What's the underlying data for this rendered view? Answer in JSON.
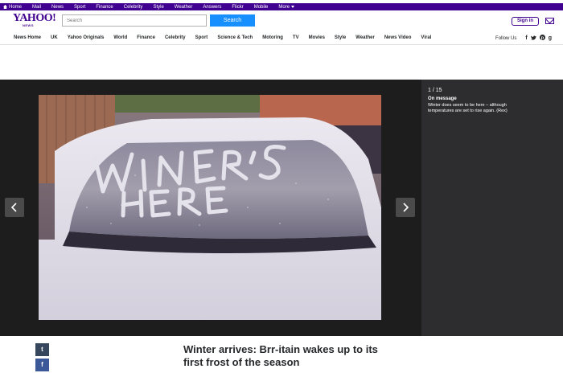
{
  "topbar": {
    "links": [
      {
        "label": "Home",
        "icon": "home-icon"
      },
      {
        "label": "Mail"
      },
      {
        "label": "News"
      },
      {
        "label": "Sport"
      },
      {
        "label": "Finance"
      },
      {
        "label": "Celebrity"
      },
      {
        "label": "Style"
      },
      {
        "label": "Weather"
      },
      {
        "label": "Answers"
      },
      {
        "label": "Flickr"
      },
      {
        "label": "Mobile"
      },
      {
        "label": "More"
      }
    ]
  },
  "header": {
    "logo": "YAHOO!",
    "logo_sub": "NEWS",
    "search_placeholder": "Search",
    "search_button": "Search",
    "signin": "Sign in"
  },
  "nav": {
    "items": [
      "News Home",
      "UK",
      "Yahoo Originals",
      "World",
      "Finance",
      "Celebrity",
      "Sport",
      "Science & Tech",
      "Motoring",
      "TV",
      "Movies",
      "Style",
      "Weather",
      "News Video",
      "Viral"
    ],
    "follow_label": "Follow Us",
    "social": [
      "f",
      "t",
      "p",
      "g"
    ]
  },
  "slideshow": {
    "counter": "1 / 15",
    "caption_title": "On message",
    "caption_text": "Winter does seem to be here – although temperatures are set to rise again. (Rex)",
    "photo_text_line1": "WINTER'S",
    "photo_text_line2": "HERE"
  },
  "article": {
    "headline": "Winter arrives: Brr-itain wakes up to its first frost of the season",
    "share_tumblr": "t",
    "share_facebook": "f"
  },
  "colors": {
    "brand_purple": "#400090",
    "search_blue": "#188fff",
    "viewer_bg": "#1d1d1d"
  }
}
